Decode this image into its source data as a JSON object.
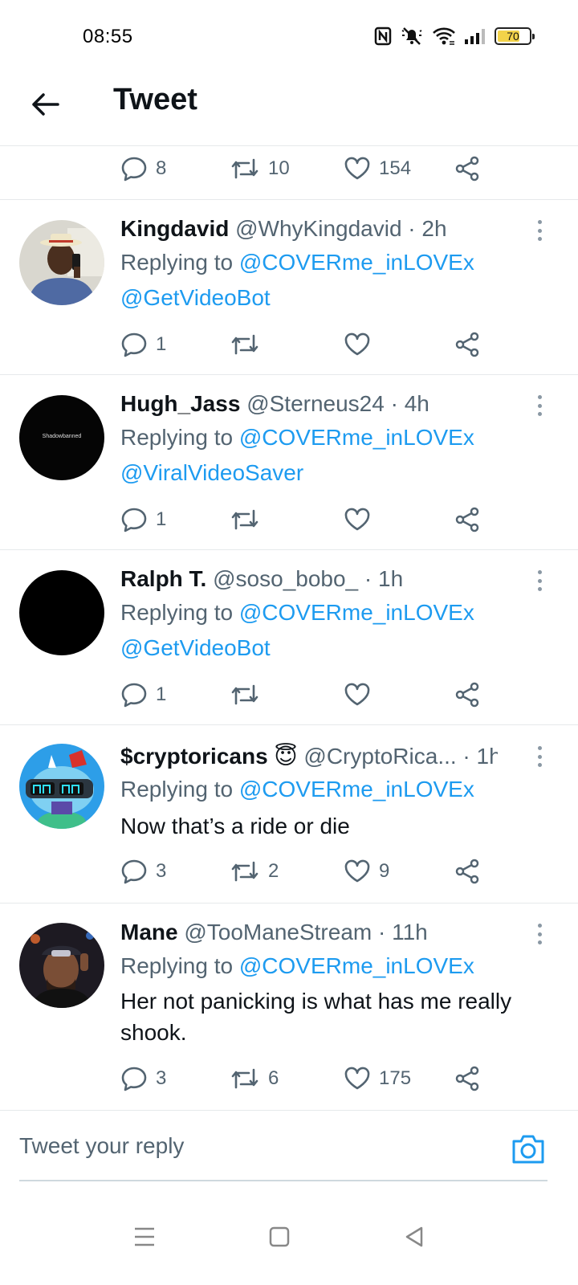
{
  "status_bar": {
    "time": "08:55",
    "battery": "70"
  },
  "header": {
    "title": "Tweet"
  },
  "top_actions": {
    "replies": "8",
    "retweets": "10",
    "likes": "154"
  },
  "tweets": [
    {
      "name": "Kingdavid",
      "handle": "@WhyKingdavid",
      "sep": " · ",
      "time": "2h",
      "replying_prefix": "Replying to ",
      "replying_to": "@COVERme_inLOVEx",
      "body": "@GetVideoBot",
      "body_is_mention": true,
      "replies": "1",
      "retweets": "",
      "likes": ""
    },
    {
      "name": "Hugh_Jass",
      "handle": "@Sterneus24",
      "sep": " · ",
      "time": "4h",
      "avatar_text": "Shadowbanned",
      "replying_prefix": "Replying to ",
      "replying_to": "@COVERme_inLOVEx",
      "body": "@ViralVideoSaver",
      "body_is_mention": true,
      "replies": "1",
      "retweets": "",
      "likes": ""
    },
    {
      "name": "Ralph T.",
      "handle": "@soso_bobo_",
      "sep": " · ",
      "time": "1h",
      "replying_prefix": "Replying to ",
      "replying_to": "@COVERme_inLOVEx",
      "body": "@GetVideoBot",
      "body_is_mention": true,
      "replies": "1",
      "retweets": "",
      "likes": ""
    },
    {
      "name": "$cryptoricans",
      "emoji": "😇",
      "handle": "@CryptoRica...",
      "sep": " · ",
      "time": "1h",
      "replying_prefix": "Replying to ",
      "replying_to": "@COVERme_inLOVEx",
      "body": "Now that’s a ride or die",
      "body_is_mention": false,
      "replies": "3",
      "retweets": "2",
      "likes": "9"
    },
    {
      "name": "Mane",
      "handle": "@TooManeStream",
      "sep": " · ",
      "time": "11h",
      "replying_prefix": "Replying to ",
      "replying_to": "@COVERme_inLOVEx",
      "body_line1": "Her not panicking is what has me really",
      "body_line2": "shook.",
      "body_is_mention": false,
      "replies": "3",
      "retweets": "6",
      "likes": "175"
    }
  ],
  "reply_bar": {
    "placeholder": "Tweet your reply"
  },
  "icons": {
    "back": "arrow-left-icon",
    "reply": "speech-bubble-icon",
    "retweet": "retweet-icon",
    "like": "heart-icon",
    "share": "share-icon",
    "more": "more-vertical-icon",
    "camera": "camera-icon",
    "menu": "menu-icon",
    "home": "square-icon",
    "back_nav": "triangle-back-icon"
  },
  "colors": {
    "accent": "#1d9bf0",
    "muted": "#536471",
    "text": "#0f1419",
    "divider": "#e6e9eb"
  }
}
